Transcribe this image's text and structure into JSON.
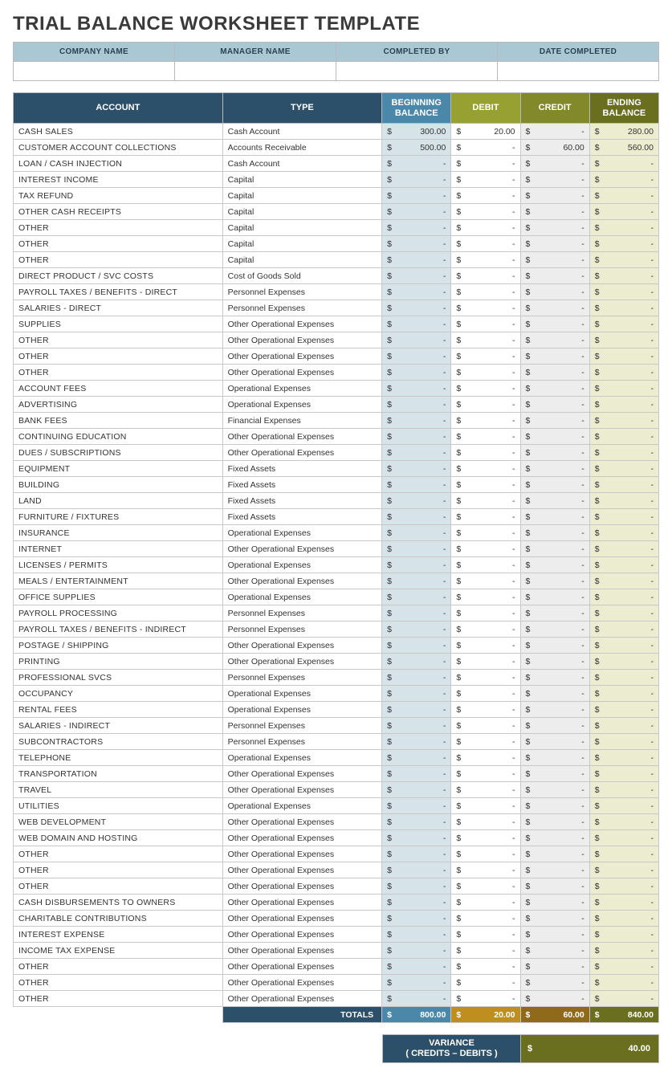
{
  "title": "TRIAL BALANCE WORKSHEET TEMPLATE",
  "meta": {
    "headers": [
      "COMPANY NAME",
      "MANAGER NAME",
      "COMPLETED BY",
      "DATE COMPLETED"
    ],
    "values": [
      "",
      "",
      "",
      ""
    ]
  },
  "columns": {
    "account": "ACCOUNT",
    "type": "TYPE",
    "beginning": "BEGINNING BALANCE",
    "debit": "DEBIT",
    "credit": "CREDIT",
    "ending": "ENDING BALANCE"
  },
  "rows": [
    {
      "account": "CASH SALES",
      "type": "Cash Account",
      "beg": "300.00",
      "debit": "20.00",
      "credit": "-",
      "end": "280.00"
    },
    {
      "account": "CUSTOMER ACCOUNT COLLECTIONS",
      "type": "Accounts Receivable",
      "beg": "500.00",
      "debit": "-",
      "credit": "60.00",
      "end": "560.00"
    },
    {
      "account": "LOAN / CASH INJECTION",
      "type": "Cash Account",
      "beg": "-",
      "debit": "-",
      "credit": "-",
      "end": "-"
    },
    {
      "account": "INTEREST INCOME",
      "type": "Capital",
      "beg": "-",
      "debit": "-",
      "credit": "-",
      "end": "-"
    },
    {
      "account": "TAX REFUND",
      "type": "Capital",
      "beg": "-",
      "debit": "-",
      "credit": "-",
      "end": "-"
    },
    {
      "account": "OTHER CASH RECEIPTS",
      "type": "Capital",
      "beg": "-",
      "debit": "-",
      "credit": "-",
      "end": "-"
    },
    {
      "account": "OTHER",
      "type": "Capital",
      "beg": "-",
      "debit": "-",
      "credit": "-",
      "end": "-"
    },
    {
      "account": "OTHER",
      "type": "Capital",
      "beg": "-",
      "debit": "-",
      "credit": "-",
      "end": "-"
    },
    {
      "account": "OTHER",
      "type": "Capital",
      "beg": "-",
      "debit": "-",
      "credit": "-",
      "end": "-"
    },
    {
      "account": "DIRECT PRODUCT / SVC COSTS",
      "type": "Cost of Goods Sold",
      "beg": "-",
      "debit": "-",
      "credit": "-",
      "end": "-"
    },
    {
      "account": "PAYROLL TAXES / BENEFITS - DIRECT",
      "type": "Personnel Expenses",
      "beg": "-",
      "debit": "-",
      "credit": "-",
      "end": "-"
    },
    {
      "account": "SALARIES - DIRECT",
      "type": "Personnel Expenses",
      "beg": "-",
      "debit": "-",
      "credit": "-",
      "end": "-"
    },
    {
      "account": "SUPPLIES",
      "type": "Other Operational Expenses",
      "beg": "-",
      "debit": "-",
      "credit": "-",
      "end": "-"
    },
    {
      "account": "OTHER",
      "type": "Other Operational Expenses",
      "beg": "-",
      "debit": "-",
      "credit": "-",
      "end": "-"
    },
    {
      "account": "OTHER",
      "type": "Other Operational Expenses",
      "beg": "-",
      "debit": "-",
      "credit": "-",
      "end": "-"
    },
    {
      "account": "OTHER",
      "type": "Other Operational Expenses",
      "beg": "-",
      "debit": "-",
      "credit": "-",
      "end": "-"
    },
    {
      "account": "ACCOUNT FEES",
      "type": "Operational Expenses",
      "beg": "-",
      "debit": "-",
      "credit": "-",
      "end": "-"
    },
    {
      "account": "ADVERTISING",
      "type": "Operational Expenses",
      "beg": "-",
      "debit": "-",
      "credit": "-",
      "end": "-"
    },
    {
      "account": "BANK FEES",
      "type": "Financial Expenses",
      "beg": "-",
      "debit": "-",
      "credit": "-",
      "end": "-"
    },
    {
      "account": "CONTINUING EDUCATION",
      "type": "Other Operational Expenses",
      "beg": "-",
      "debit": "-",
      "credit": "-",
      "end": "-"
    },
    {
      "account": "DUES / SUBSCRIPTIONS",
      "type": "Other Operational Expenses",
      "beg": "-",
      "debit": "-",
      "credit": "-",
      "end": "-"
    },
    {
      "account": "EQUIPMENT",
      "type": "Fixed Assets",
      "beg": "-",
      "debit": "-",
      "credit": "-",
      "end": "-"
    },
    {
      "account": "BUILDING",
      "type": "Fixed Assets",
      "beg": "-",
      "debit": "-",
      "credit": "-",
      "end": "-"
    },
    {
      "account": "LAND",
      "type": "Fixed Assets",
      "beg": "-",
      "debit": "-",
      "credit": "-",
      "end": "-"
    },
    {
      "account": "FURNITURE / FIXTURES",
      "type": "Fixed Assets",
      "beg": "-",
      "debit": "-",
      "credit": "-",
      "end": "-"
    },
    {
      "account": "INSURANCE",
      "type": "Operational Expenses",
      "beg": "-",
      "debit": "-",
      "credit": "-",
      "end": "-"
    },
    {
      "account": "INTERNET",
      "type": "Other Operational Expenses",
      "beg": "-",
      "debit": "-",
      "credit": "-",
      "end": "-"
    },
    {
      "account": "LICENSES / PERMITS",
      "type": "Operational Expenses",
      "beg": "-",
      "debit": "-",
      "credit": "-",
      "end": "-"
    },
    {
      "account": "MEALS / ENTERTAINMENT",
      "type": "Other Operational Expenses",
      "beg": "-",
      "debit": "-",
      "credit": "-",
      "end": "-"
    },
    {
      "account": "OFFICE SUPPLIES",
      "type": "Operational Expenses",
      "beg": "-",
      "debit": "-",
      "credit": "-",
      "end": "-"
    },
    {
      "account": "PAYROLL PROCESSING",
      "type": "Personnel Expenses",
      "beg": "-",
      "debit": "-",
      "credit": "-",
      "end": "-"
    },
    {
      "account": "PAYROLL TAXES / BENEFITS - INDIRECT",
      "type": "Personnel Expenses",
      "beg": "-",
      "debit": "-",
      "credit": "-",
      "end": "-"
    },
    {
      "account": "POSTAGE / SHIPPING",
      "type": "Other Operational Expenses",
      "beg": "-",
      "debit": "-",
      "credit": "-",
      "end": "-"
    },
    {
      "account": "PRINTING",
      "type": "Other Operational Expenses",
      "beg": "-",
      "debit": "-",
      "credit": "-",
      "end": "-"
    },
    {
      "account": "PROFESSIONAL SVCS",
      "type": "Personnel Expenses",
      "beg": "-",
      "debit": "-",
      "credit": "-",
      "end": "-"
    },
    {
      "account": "OCCUPANCY",
      "type": "Operational Expenses",
      "beg": "-",
      "debit": "-",
      "credit": "-",
      "end": "-"
    },
    {
      "account": "RENTAL FEES",
      "type": "Operational Expenses",
      "beg": "-",
      "debit": "-",
      "credit": "-",
      "end": "-"
    },
    {
      "account": "SALARIES - INDIRECT",
      "type": "Personnel Expenses",
      "beg": "-",
      "debit": "-",
      "credit": "-",
      "end": "-"
    },
    {
      "account": "SUBCONTRACTORS",
      "type": "Personnel Expenses",
      "beg": "-",
      "debit": "-",
      "credit": "-",
      "end": "-"
    },
    {
      "account": "TELEPHONE",
      "type": "Operational Expenses",
      "beg": "-",
      "debit": "-",
      "credit": "-",
      "end": "-"
    },
    {
      "account": "TRANSPORTATION",
      "type": "Other Operational Expenses",
      "beg": "-",
      "debit": "-",
      "credit": "-",
      "end": "-"
    },
    {
      "account": "TRAVEL",
      "type": "Other Operational Expenses",
      "beg": "-",
      "debit": "-",
      "credit": "-",
      "end": "-"
    },
    {
      "account": "UTILITIES",
      "type": "Operational Expenses",
      "beg": "-",
      "debit": "-",
      "credit": "-",
      "end": "-"
    },
    {
      "account": "WEB DEVELOPMENT",
      "type": "Other Operational Expenses",
      "beg": "-",
      "debit": "-",
      "credit": "-",
      "end": "-"
    },
    {
      "account": "WEB DOMAIN AND HOSTING",
      "type": "Other Operational Expenses",
      "beg": "-",
      "debit": "-",
      "credit": "-",
      "end": "-"
    },
    {
      "account": "OTHER",
      "type": "Other Operational Expenses",
      "beg": "-",
      "debit": "-",
      "credit": "-",
      "end": "-"
    },
    {
      "account": "OTHER",
      "type": "Other Operational Expenses",
      "beg": "-",
      "debit": "-",
      "credit": "-",
      "end": "-"
    },
    {
      "account": "OTHER",
      "type": "Other Operational Expenses",
      "beg": "-",
      "debit": "-",
      "credit": "-",
      "end": "-"
    },
    {
      "account": "CASH DISBURSEMENTS TO OWNERS",
      "type": "Other Operational Expenses",
      "beg": "-",
      "debit": "-",
      "credit": "-",
      "end": "-"
    },
    {
      "account": "CHARITABLE CONTRIBUTIONS",
      "type": "Other Operational Expenses",
      "beg": "-",
      "debit": "-",
      "credit": "-",
      "end": "-"
    },
    {
      "account": "INTEREST EXPENSE",
      "type": "Other Operational Expenses",
      "beg": "-",
      "debit": "-",
      "credit": "-",
      "end": "-"
    },
    {
      "account": "INCOME TAX EXPENSE",
      "type": "Other Operational Expenses",
      "beg": "-",
      "debit": "-",
      "credit": "-",
      "end": "-"
    },
    {
      "account": "OTHER",
      "type": "Other Operational Expenses",
      "beg": "-",
      "debit": "-",
      "credit": "-",
      "end": "-"
    },
    {
      "account": "OTHER",
      "type": "Other Operational Expenses",
      "beg": "-",
      "debit": "-",
      "credit": "-",
      "end": "-"
    },
    {
      "account": "OTHER",
      "type": "Other Operational Expenses",
      "beg": "-",
      "debit": "-",
      "credit": "-",
      "end": "-"
    }
  ],
  "totals": {
    "label": "TOTALS",
    "beg": "800.00",
    "debit": "20.00",
    "credit": "60.00",
    "end": "840.00"
  },
  "variance": {
    "label1": "VARIANCE",
    "label2": "( CREDITS – DEBITS )",
    "value": "40.00"
  }
}
